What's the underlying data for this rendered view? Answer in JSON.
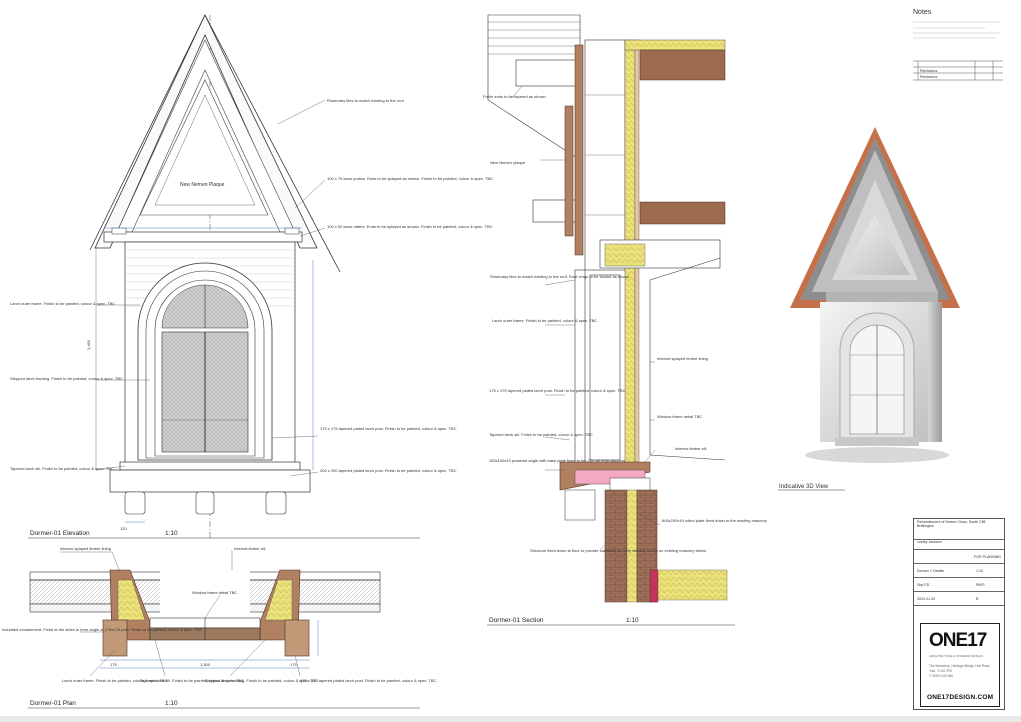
{
  "elevation": {
    "title": "Dormer-01   Elevation",
    "scale": "1:10",
    "plaque_label": "New Nemen Plaque",
    "notes": [
      "Rosemary tiles to match existing to the roof",
      "100 x 75 larch purlins. Ends to be splayed as shown. Finish to be painted, colour & spec. TBC",
      "100 x 50 larch rafters. Ends to be splayed as shown. Finish to be painted, colour & spec. TBC",
      "Larch outer frame. Finish to be painted, colour & spec. TBC",
      "Stepped larch framing. Finish to be painted, colour & spec. TBC",
      "175 x 175 tapered plated larch post. Finish to be painted, colour & spec. TBC",
      "Tapered larch sill. Finish to be painted, colour & spec. TBC",
      "200 x 200 tapered plated larch post. Finish to be painted, colour & spec. TBC"
    ]
  },
  "plan": {
    "title": "Dormer-01   Plan",
    "scale": "1:10",
    "notes": [
      "Internal splayed timber lining",
      "Internal timber sill",
      "Window frame detail TBC",
      "Insulated encasement. Fixed at the sides to form angle at 175x175 post. Finish to be painted, colour & spec. TBC",
      "Larch outer frame. Finish to be painted, colour & spec. TBC",
      "Tapered larch sill. Finish to be painted, colour & spec. TBC",
      "Stepped larch framing. Finish to be painted, colour & spec. TBC",
      "175 x 175 tapered plated larch post. Finish to be painted, colour & spec. TBC"
    ]
  },
  "section": {
    "title": "Dormer-01   Section",
    "scale": "1:10",
    "notes": [
      "Purlin ends to be tapered as shown",
      "New Nemen plaque",
      "Rosemary tiles to match existing to the roof. Roof verge to be tucked as shown",
      "Larch outer frame. Finish to be painted, colour & spec. TBC",
      "175 x 175 tapered plated larch post. Finish to be painted, colour & spec. TBC",
      "Tapered larch sill. Finish to be painted, colour & spec. TBC",
      "150x100x10 powered angle with base plate fixed to the 20x sill resin anchors",
      "Internal splayed timber lining",
      "Window frame detail TBC",
      "Internal timber sill",
      "600x200x10 rolled plate fixed down to the existing masonry",
      "Structure fixed down to floor to provide cantilever to carry window to rest on existing masonry below"
    ]
  },
  "view3d": {
    "title": "Indicative 3D View"
  },
  "notes_panel": {
    "heading": "Notes",
    "rev_a": "Revisions",
    "rev_b": "Revisions"
  },
  "titleblock": {
    "project": "Refurbishment of Nelson Close, South Cliff, Bridlington",
    "client": "Lesley Jackson",
    "sheet_title": "Dormer 1 Details",
    "scale": "1:10",
    "drawn": "ShpT/D",
    "check": "RWG",
    "date": "2023.01.20",
    "rev": "B",
    "status": "FOR PLANNING"
  },
  "logo": {
    "main": "ONE17",
    "sub": "ARCHITECTURE & INTERIOR DESIGN",
    "address": "The Workshop, Heritage Bridge, Hull Road, York, YO10 3PD",
    "phone": "T 01904 426 666",
    "url": "ONE17DESIGN.COM"
  },
  "colors": {
    "timber": "#b08060",
    "insulation": "#e8df7a",
    "membrane_pink": "#f4a8c4",
    "brick": "#9c6b4e",
    "dim_blue": "#5a78c8",
    "roof_tile": "#c6704a"
  }
}
